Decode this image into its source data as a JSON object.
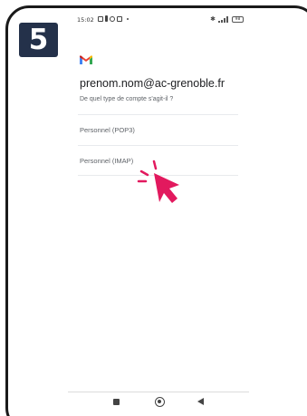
{
  "step": {
    "number": "5"
  },
  "status_bar": {
    "time": "15:02",
    "battery": "98",
    "icons": [
      "image-icon",
      "notification-icon",
      "alarm-icon",
      "grid-icon",
      "dot-icon",
      "bluetooth-icon",
      "signal-icon",
      "battery-icon"
    ]
  },
  "app": {
    "logo": "gmail-logo"
  },
  "account": {
    "email": "prenom.nom@ac-grenoble.fr",
    "question": "De quel type de compte s'agit-il ?"
  },
  "options": [
    {
      "label": "Personnel (POP3)"
    },
    {
      "label": "Personnel (IMAP)"
    }
  ],
  "pointer": {
    "icon": "click-pointer-icon",
    "color": "#e2195e"
  },
  "nav": {
    "icons": [
      "recent-apps-icon",
      "home-icon",
      "back-icon"
    ]
  },
  "colors": {
    "badge": "#24314a",
    "accent": "#e2195e"
  }
}
